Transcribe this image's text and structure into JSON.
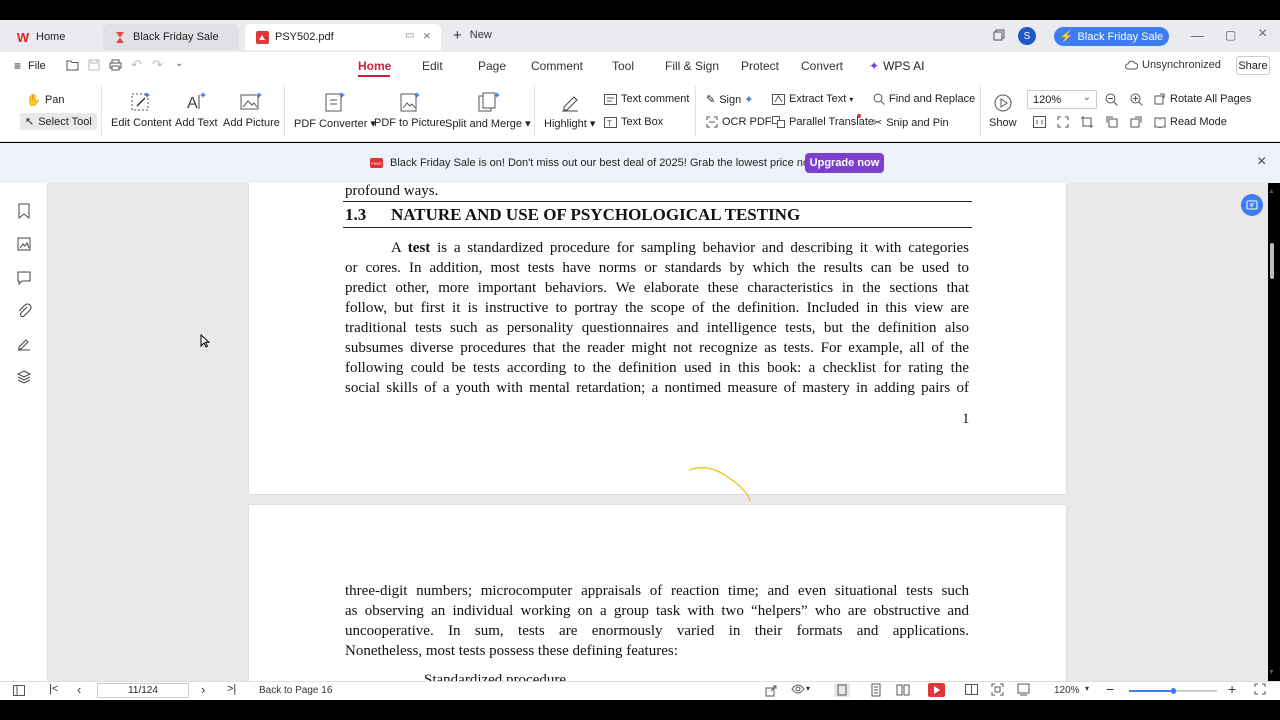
{
  "tabs": {
    "home": "Home",
    "sale": "Black Friday Sale",
    "doc": "PSY502.pdf",
    "new": "New"
  },
  "header": {
    "black_friday": "Black Friday Sale",
    "avatar": "S",
    "unsync": "Unsynchronized",
    "share": "Share"
  },
  "menu": {
    "file": "File",
    "items": [
      "Home",
      "Edit",
      "Page",
      "Comment",
      "Tool",
      "Fill & Sign",
      "Protect",
      "Convert",
      "WPS AI"
    ]
  },
  "toolbar": {
    "pan": "Pan",
    "select_tool": "Select Tool",
    "edit_content": "Edit Content",
    "add_text": "Add Text",
    "add_picture": "Add Picture",
    "pdf_converter": "PDF Converter",
    "pdf_to_picture": "PDF to Picture",
    "split_merge": "Split and Merge",
    "highlight": "Highlight",
    "text_comment": "Text comment",
    "text_box": "Text Box",
    "sign": "Sign",
    "ocr_pdf": "OCR PDF",
    "extract_text": "Extract Text",
    "parallel_translate": "Parallel Translate",
    "find_replace": "Find and Replace",
    "snip_pin": "Snip and Pin",
    "show": "Show",
    "zoom_value": "120%",
    "rotate_all": "Rotate All Pages",
    "read_mode": "Read Mode"
  },
  "banner": {
    "badge": "FREE",
    "text": "Black Friday Sale is on! Don't miss out our best deal of 2025! Grab the lowest price now →",
    "button": "Upgrade now"
  },
  "document": {
    "prev_tail": "profound ways.",
    "section_number": "1.3",
    "section_title": "NATURE AND USE OF PSYCHOLOGICAL TESTING",
    "p1_lines": [
      "or cores. In addition, most tests have norms or standards by which the results can be used to",
      "predict other, more important behaviors. We elaborate these characteristics in the sections that",
      "follow, but first it is instructive to portray the scope of the definition. Included in this view are",
      "traditional tests such as personality questionnaires and intelligence tests, but the definition also",
      "subsumes diverse procedures that the reader might not recognize as tests. For example, all of the",
      "following could be tests according to the definition used in this book: a checklist for rating the",
      "social skills of a youth with mental retardation; a nontimed measure of mastery in adding pairs of"
    ],
    "p1_first_a": "A ",
    "p1_first_bold": "test",
    "p1_first_rest": " is a standardized procedure for sampling behavior and describing it with categories",
    "page_number": "1",
    "p2_lines": [
      "three-digit numbers; microcomputer appraisals of reaction time; and even situational tests such",
      "as observing an individual working on a group task with two “helpers” who are obstructive and",
      "uncooperative. In sum, tests are enormously varied in their formats and applications."
    ],
    "p2_last": "Nonetheless, most tests possess these defining features:",
    "p2_cut": "Standardized procedure"
  },
  "status": {
    "page_input": "11/124",
    "back_to": "Back to Page 16",
    "zoom": "120%"
  },
  "colors": {
    "accent": "#c6223b",
    "primary_blue": "#3d7cf2",
    "upgrade_purple": "#7d3fd0"
  }
}
